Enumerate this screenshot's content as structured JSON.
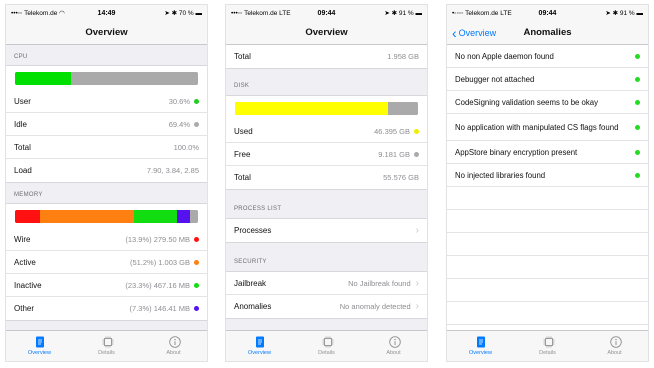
{
  "screen1": {
    "status": {
      "carrier": "•••◦◦ Telekom.de ◠",
      "time": "14:49",
      "battery": "➤ ✱ 70 % ▬"
    },
    "title": "Overview",
    "cpu": {
      "header": "CPU",
      "bar": [
        {
          "color": "#00e000",
          "fraction": 0.306
        },
        {
          "color": "#aaaaaa",
          "fraction": 0.694
        }
      ],
      "rows": [
        {
          "label": "User",
          "value": "30.6%",
          "dot": "#22cc22"
        },
        {
          "label": "Idle",
          "value": "69.4%",
          "dot": "#aaaaaa"
        },
        {
          "label": "Total",
          "value": "100.0%"
        },
        {
          "label": "Load",
          "value": "7.90, 3.84, 2.85"
        }
      ]
    },
    "memory": {
      "header": "MEMORY",
      "bar": [
        {
          "color": "#ff1111",
          "fraction": 0.139
        },
        {
          "color": "#ff7f11",
          "fraction": 0.512
        },
        {
          "color": "#11dd11",
          "fraction": 0.233
        },
        {
          "color": "#5511ee",
          "fraction": 0.073
        },
        {
          "color": "#aaaaaa",
          "fraction": 0.043
        }
      ],
      "rows": [
        {
          "label": "Wire",
          "value": "(13.9%) 279.50 MB",
          "dot": "#ff1111"
        },
        {
          "label": "Active",
          "value": "(51.2%) 1.003 GB",
          "dot": "#ff7f11"
        },
        {
          "label": "Inactive",
          "value": "(23.3%) 467.16 MB",
          "dot": "#11dd11"
        },
        {
          "label": "Other",
          "value": "(7.3%) 146.41 MB",
          "dot": "#5511ee"
        }
      ]
    }
  },
  "screen2": {
    "status": {
      "carrier": "•••◦◦ Telekom.de LTE",
      "time": "09:44",
      "battery": "➤ ✱ 91 % ▬"
    },
    "title": "Overview",
    "top_row": {
      "label": "Total",
      "value": "1.958 GB"
    },
    "disk": {
      "header": "DISK",
      "bar": [
        {
          "color": "#ffff00",
          "fraction": 0.834
        },
        {
          "color": "#aaaaaa",
          "fraction": 0.166
        }
      ],
      "rows": [
        {
          "label": "Used",
          "value": "46.395 GB",
          "dot": "#eeee00"
        },
        {
          "label": "Free",
          "value": "9.181 GB",
          "dot": "#aaaaaa"
        },
        {
          "label": "Total",
          "value": "55.576 GB"
        }
      ]
    },
    "process": {
      "header": "PROCESS LIST",
      "rows": [
        {
          "label": "Processes",
          "value": ""
        }
      ]
    },
    "security": {
      "header": "SECURITY",
      "rows": [
        {
          "label": "Jailbreak",
          "value": "No Jailbreak found"
        },
        {
          "label": "Anomalies",
          "value": "No anomaly detected"
        }
      ]
    }
  },
  "screen3": {
    "status": {
      "carrier": "•◦◦◦◦ Telekom.de LTE",
      "time": "09:44",
      "battery": "➤ ✱ 91 % ▬"
    },
    "back_label": "Overview",
    "title": "Anomalies",
    "items": [
      {
        "label": "No non Apple daemon found",
        "dot": "#22dd22"
      },
      {
        "label": "Debugger not attached",
        "dot": "#22dd22"
      },
      {
        "label": "CodeSigning validation seems to be okay",
        "dot": "#22dd22"
      },
      {
        "label": "No application with manipulated CS flags found",
        "dot": "#22dd22"
      },
      {
        "label": "AppStore binary encryption present",
        "dot": "#22dd22"
      },
      {
        "label": "No injected libraries found",
        "dot": "#22dd22"
      }
    ]
  },
  "tabs": [
    {
      "label": "Overview",
      "icon": "document-icon"
    },
    {
      "label": "Details",
      "icon": "chip-icon"
    },
    {
      "label": "About",
      "icon": "info-icon"
    }
  ],
  "colors": {
    "accent": "#007aff",
    "separator": "#c8c7cc",
    "grouped_bg": "#efeff4"
  }
}
